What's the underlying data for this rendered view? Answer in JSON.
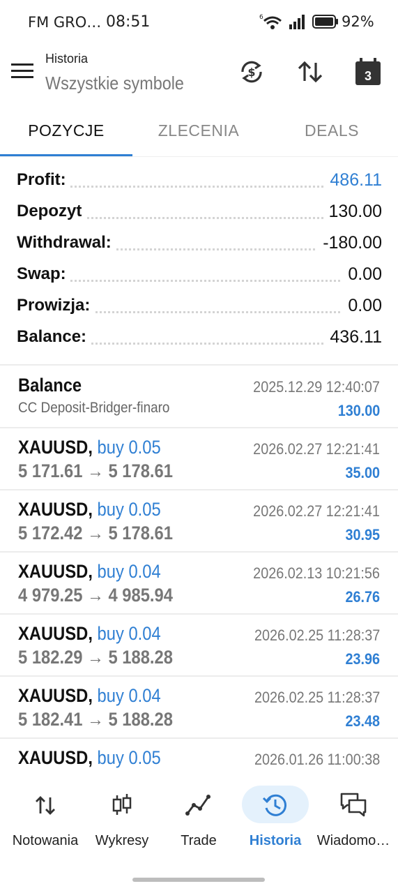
{
  "status_bar": {
    "carrier": "FM GRO…",
    "time": "08:51",
    "battery": "92%"
  },
  "header": {
    "subtitle": "Historia",
    "title": "Wszystkie symbole",
    "calendar_day": "3"
  },
  "tabs": [
    {
      "label": "POZYCJE",
      "active": true
    },
    {
      "label": "ZLECENIA",
      "active": false
    },
    {
      "label": "DEALS",
      "active": false
    }
  ],
  "summary": [
    {
      "label": "Profit:",
      "value": "486.11",
      "accent": true
    },
    {
      "label": "Depozyt",
      "value": "130.00",
      "accent": false
    },
    {
      "label": "Withdrawal:",
      "value": "-180.00",
      "accent": false
    },
    {
      "label": "Swap:",
      "value": "0.00",
      "accent": false
    },
    {
      "label": "Prowizja:",
      "value": "0.00",
      "accent": false
    },
    {
      "label": "Balance:",
      "value": "436.11",
      "accent": false
    }
  ],
  "balance_entry": {
    "title": "Balance",
    "comment": "CC Deposit-Bridger-finaro",
    "date": "2025.12.29 12:40:07",
    "amount": "130.00"
  },
  "deals": [
    {
      "symbol": "XAUUSD,",
      "side": "buy 0.05",
      "prices": "5 171.61 → 5 178.61",
      "date": "2026.02.27 12:21:41",
      "profit": "35.00"
    },
    {
      "symbol": "XAUUSD,",
      "side": "buy 0.05",
      "prices": "5 172.42 → 5 178.61",
      "date": "2026.02.27 12:21:41",
      "profit": "30.95"
    },
    {
      "symbol": "XAUUSD,",
      "side": "buy 0.04",
      "prices": "4 979.25 → 4 985.94",
      "date": "2026.02.13 10:21:56",
      "profit": "26.76"
    },
    {
      "symbol": "XAUUSD,",
      "side": "buy 0.04",
      "prices": "5 182.29 → 5 188.28",
      "date": "2026.02.25 11:28:37",
      "profit": "23.96"
    },
    {
      "symbol": "XAUUSD,",
      "side": "buy 0.04",
      "prices": "5 182.41 → 5 188.28",
      "date": "2026.02.25 11:28:37",
      "profit": "23.48"
    },
    {
      "symbol": "XAUUSD,",
      "side": "buy 0.05",
      "prices": "",
      "date": "2026.01.26 11:00:38",
      "profit": ""
    }
  ],
  "bottom_nav": [
    {
      "label": "Notowania",
      "icon": "quotes-arrows-icon",
      "active": false
    },
    {
      "label": "Wykresy",
      "icon": "candlestick-chart-icon",
      "active": false
    },
    {
      "label": "Trade",
      "icon": "trade-line-icon",
      "active": false
    },
    {
      "label": "Historia",
      "icon": "history-clock-icon",
      "active": true
    },
    {
      "label": "Wiadomo…",
      "icon": "messages-icon",
      "active": false
    }
  ],
  "colors": {
    "accent": "#2f7fd3",
    "active_pill": "#e4f1fc",
    "muted_text": "#777777"
  }
}
